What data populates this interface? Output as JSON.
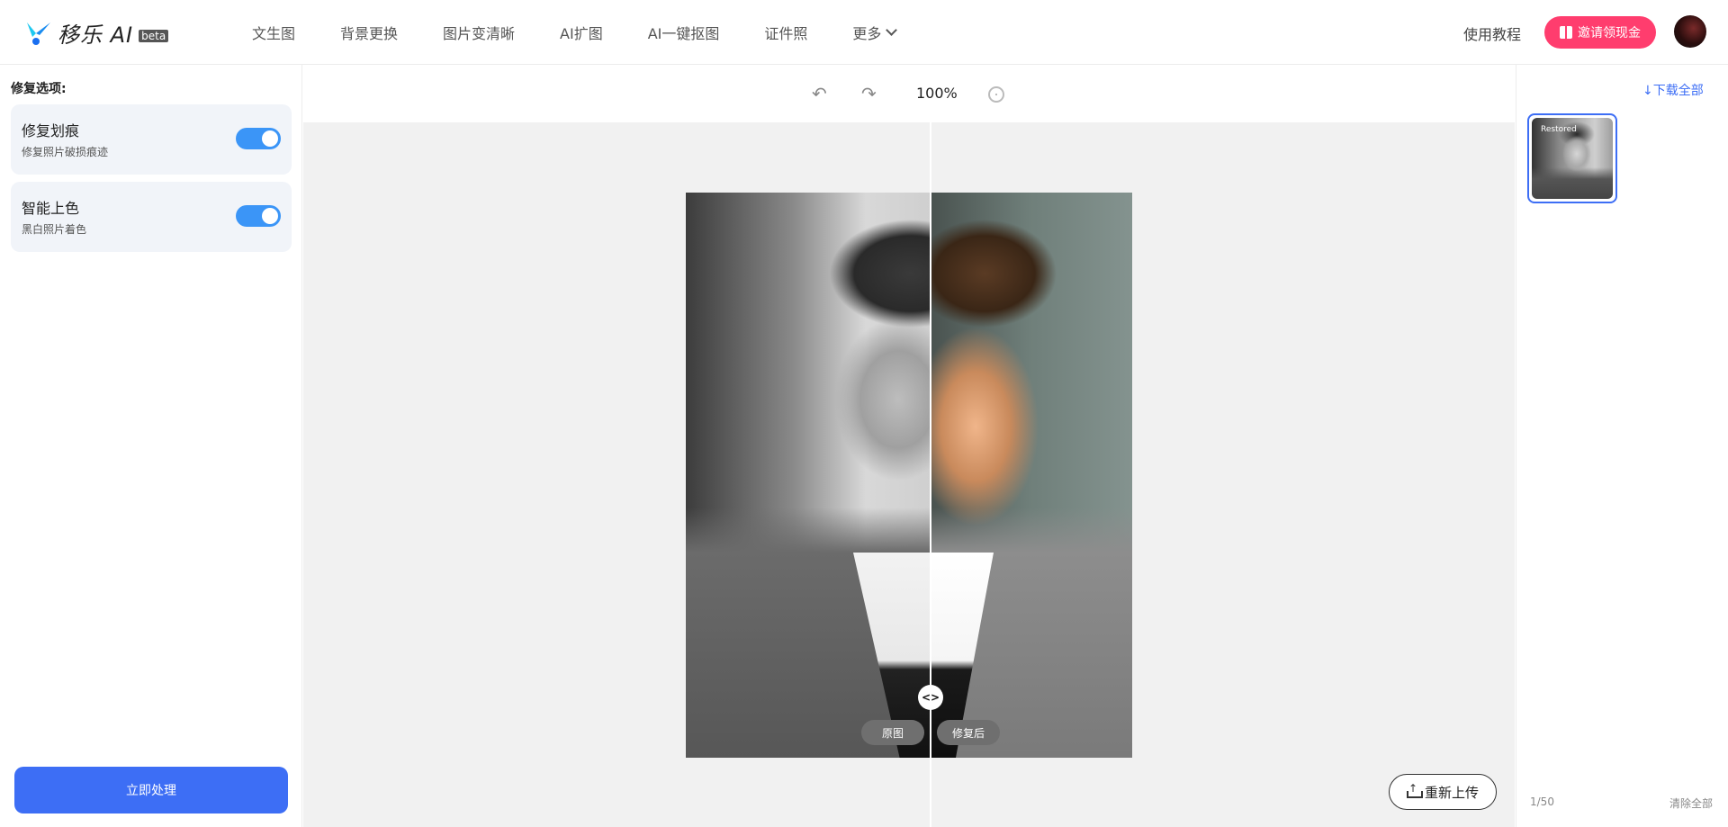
{
  "header": {
    "logo_text": "移乐 AI",
    "beta": "beta",
    "nav": [
      {
        "label": "文生图"
      },
      {
        "label": "背景更换"
      },
      {
        "label": "图片变清晰"
      },
      {
        "label": "AI扩图"
      },
      {
        "label": "AI一键抠图"
      },
      {
        "label": "证件照"
      },
      {
        "label": "更多"
      }
    ],
    "tutorial": "使用教程",
    "invite": "邀请领现金",
    "brand_color": "#3d6ef5",
    "invite_color": "#ff3d6e"
  },
  "left_panel": {
    "title": "修复选项:",
    "options": [
      {
        "title": "修复划痕",
        "subtitle": "修复照片破损痕迹",
        "enabled": true
      },
      {
        "title": "智能上色",
        "subtitle": "黑白照片着色",
        "enabled": true
      }
    ],
    "process_button": "立即处理"
  },
  "toolbar": {
    "undo_icon": "undo-icon",
    "redo_icon": "redo-icon",
    "zoom": "100%",
    "center_icon": "crosshair-icon"
  },
  "compare": {
    "before_label": "原图",
    "after_label": "修复后",
    "handle_icon": "<>"
  },
  "reupload": "重新上传",
  "right_panel": {
    "download_all": "下载全部",
    "thumb_label": "Restored",
    "count": "1/50",
    "clear_all": "清除全部"
  }
}
